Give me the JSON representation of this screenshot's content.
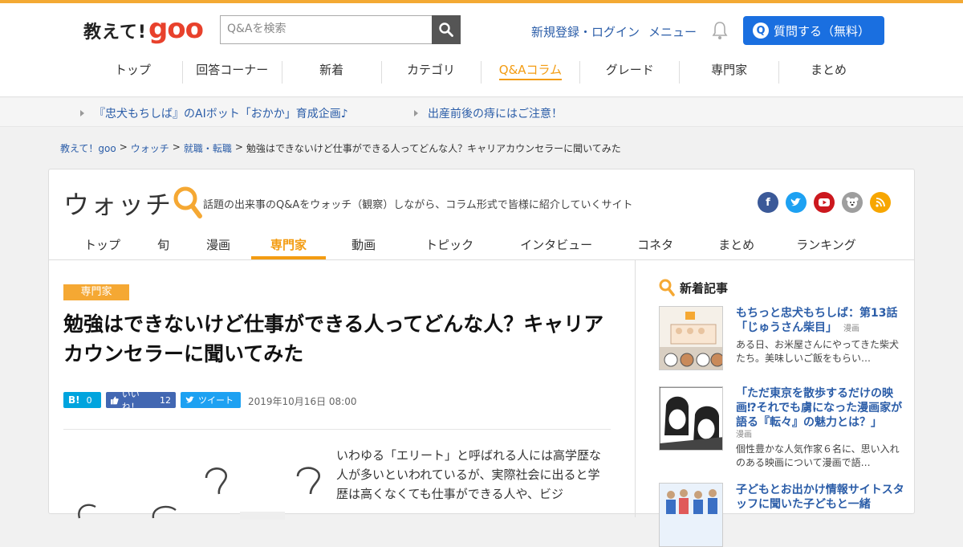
{
  "header": {
    "logo_ja": "教えて!",
    "logo_goo": "goo",
    "search_placeholder": "Q&Aを検索",
    "register_login": "新規登録・ログイン",
    "menu": "メニュー",
    "ask_button": "質問する（無料）",
    "ask_icon": "Q",
    "nav": [
      "トップ",
      "回答コーナー",
      "新着",
      "カテゴリ",
      "Q&Aコラム",
      "グレード",
      "専門家",
      "まとめ"
    ],
    "nav_active_index": 4
  },
  "notices": [
    "『忠犬もちしば』のAIボット「おかか」育成企画♪",
    "出産前後の痔にはご注意！"
  ],
  "breadcrumb": {
    "items": [
      "教えて！goo",
      "ウォッチ",
      "就職・転職"
    ],
    "current": "勉強はできないけど仕事ができる人ってどんな人？キャリアカウンセラーに聞いてみた",
    "separator": ">"
  },
  "watch": {
    "logo_text": "ウォッチ",
    "tagline": "話題の出来事のQ&Aをウォッチ（観察）しながら、コラム形式で皆様に紹介していくサイト",
    "social_icons": [
      "facebook-icon",
      "twitter-icon",
      "youtube-icon",
      "goo-bear-icon",
      "rss-icon"
    ],
    "social_colors": [
      "#3b5998",
      "#1da1f2",
      "#cc181e",
      "#9e9e9e",
      "#f7a600"
    ],
    "tabs": [
      "トップ",
      "旬",
      "漫画",
      "専門家",
      "動画",
      "トピック",
      "インタビュー",
      "コネタ",
      "まとめ",
      "ランキング"
    ],
    "active_tab_index": 3
  },
  "article": {
    "category": "専門家",
    "title": "勉強はできないけど仕事ができる人ってどんな人？キャリアカウンセラーに聞いてみた",
    "share": {
      "hatena_label": "B!",
      "hatena_count": "0",
      "like_label": "いいね！",
      "like_count": "12",
      "tweet_label": "ツイート"
    },
    "date": "2019年10月16日 08:00",
    "lead": "いわゆる「エリート」と呼ばれる人には高学歴な人が多いといわれているが、実際社会に出ると学歴は高くなくても仕事ができる人や、ビジ"
  },
  "sidebar": {
    "heading": "新着記事",
    "items": [
      {
        "title": "もちっと忠犬もちしば：第13話「じゅうさん柴目」",
        "tag": "漫画",
        "desc": "ある日、お米屋さんにやってきた柴犬たち。美味しいご飯をもらい…"
      },
      {
        "title": "「ただ東京を散歩するだけの映画⁉それでも虜になった漫画家が語る『転々』の魅力とは？」",
        "tag": "漫画",
        "desc": "個性豊かな人気作家６名に、思い入れのある映画について漫画で語…"
      },
      {
        "title": "子どもとお出かけ情報サイトスタッフに聞いた子どもと一緒",
        "tag": "",
        "desc": ""
      }
    ]
  },
  "colors": {
    "accent_orange": "#f39c12",
    "link_blue": "#2b5da8",
    "ask_blue": "#1a6fe0",
    "goo_red": "#e8412c"
  }
}
